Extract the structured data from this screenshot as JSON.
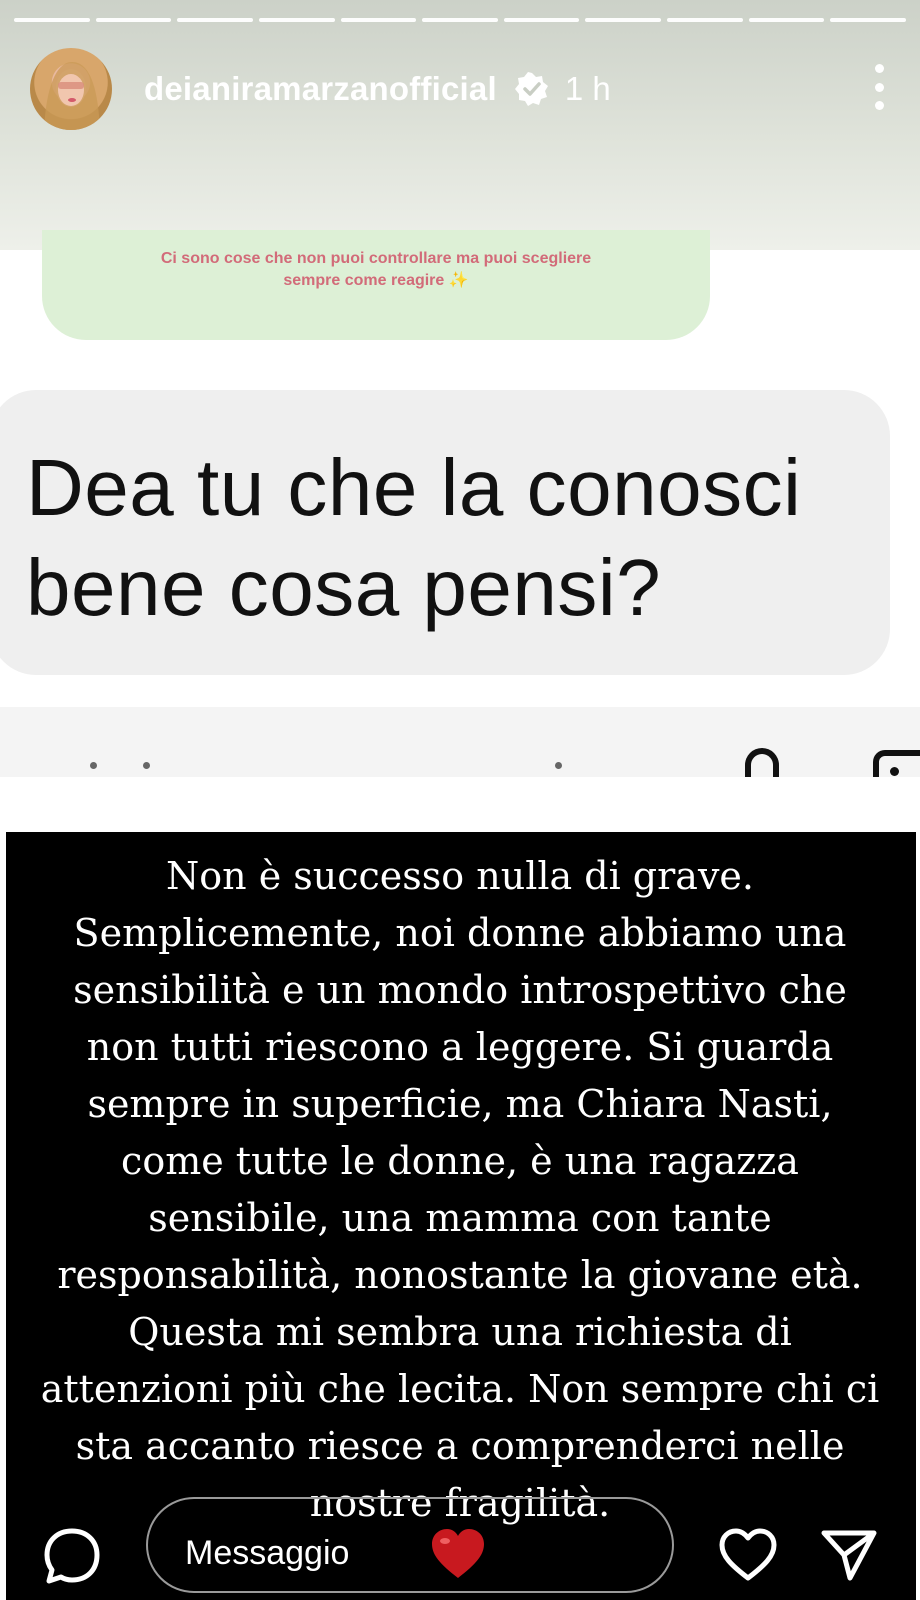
{
  "story": {
    "segments": 11,
    "username": "deianiramarzanofficial",
    "time": "1 h"
  },
  "quoted_story": {
    "text_line1": "Ci sono cose che non puoi controllare ma puoi scegliere",
    "text_line2": "sempre come reagire ✨"
  },
  "question": {
    "line1": "Dea tu che la conosci",
    "line2": "bene cosa pensi?"
  },
  "statement": {
    "lines": [
      "Non è successo nulla di grave.",
      "Semplicemente, noi donne abbiamo una",
      "sensibilità e un mondo introspettivo che",
      "non tutti riescono a leggere. Si guarda",
      "sempre in superficie, ma Chiara Nasti,",
      "come tutte le donne, è una ragazza",
      "sensibile, una mamma con tante",
      "responsabilità, nonostante la giovane età.",
      "Questa mi sembra una richiesta di",
      "attenzioni più che lecita. Non sempre chi ci",
      "sta accanto riesce a comprenderci nelle",
      "nostre fragilità."
    ]
  },
  "footer": {
    "message_placeholder": "Messaggio",
    "icons": [
      "chat-bubble-icon",
      "heart-emoji",
      "like-heart-icon",
      "send-icon"
    ]
  },
  "colors": {
    "quoted_bg": "#ddf0d6",
    "quoted_text": "#d26b79",
    "bubble_bg": "#efefef",
    "card_bg": "#000000"
  }
}
